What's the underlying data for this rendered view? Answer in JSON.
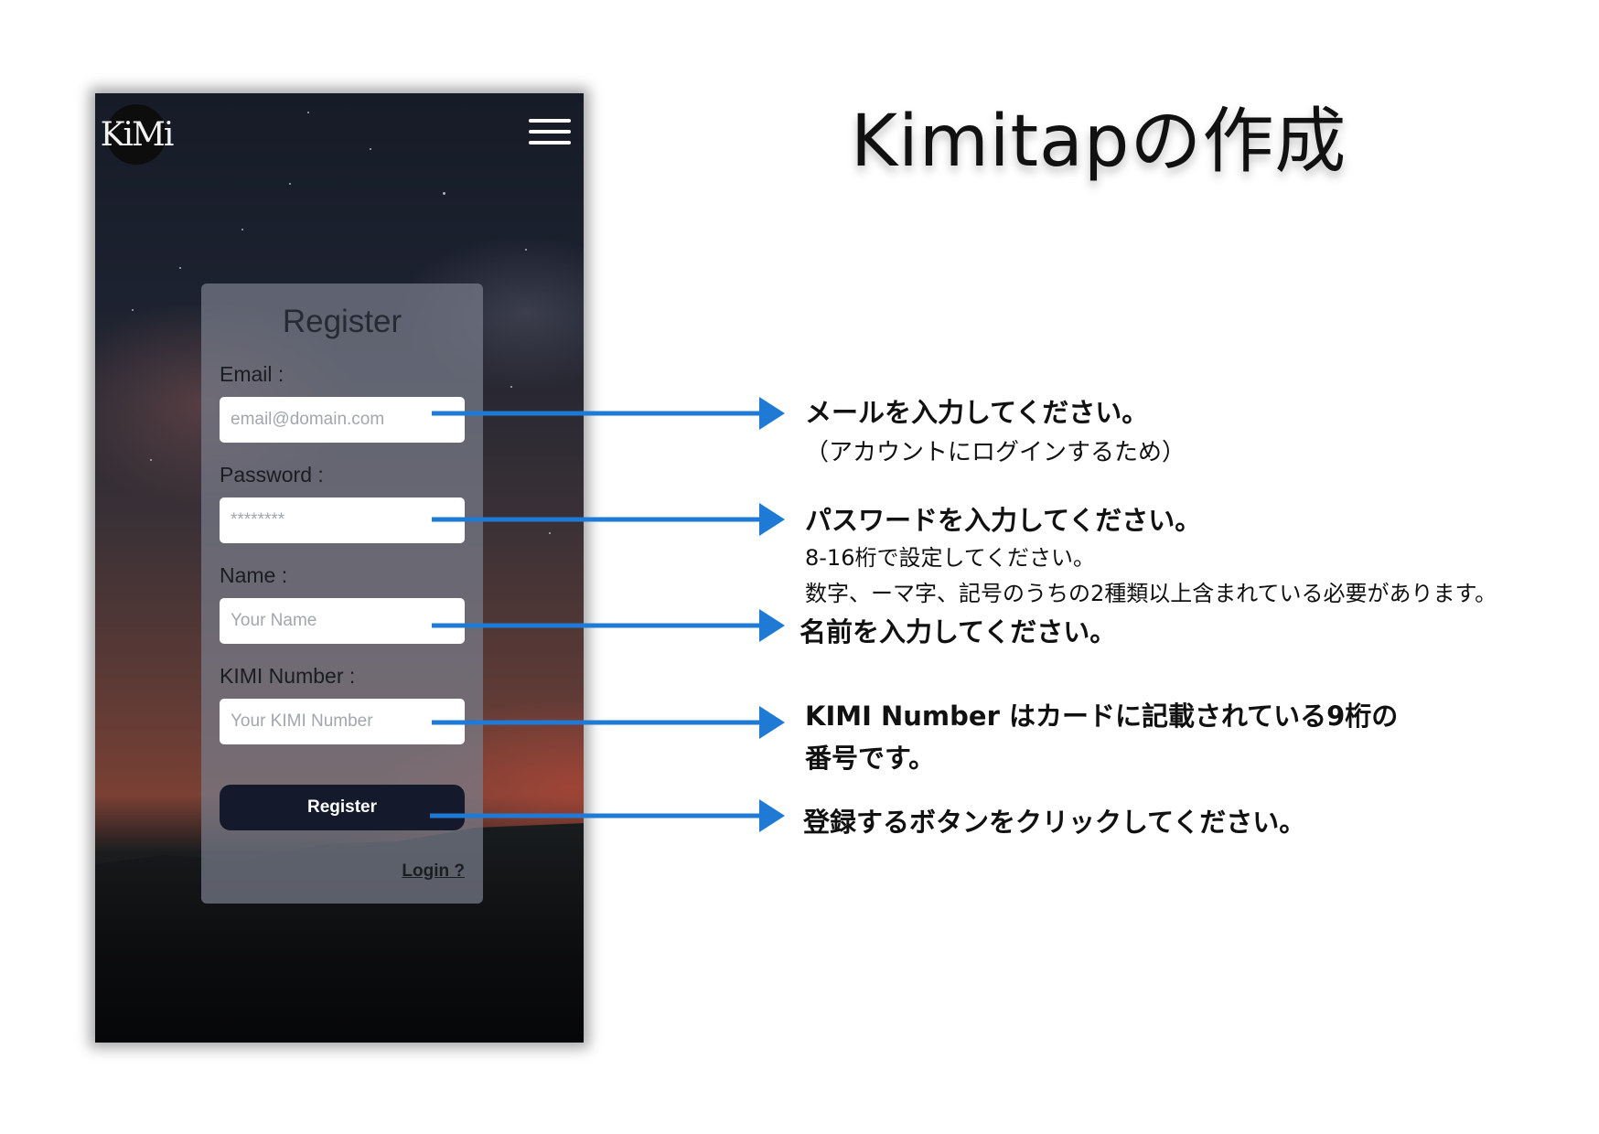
{
  "page_title": "Kimitapの作成",
  "app": {
    "logo_text": "KiMi",
    "menu_icon": "hamburger-menu-icon"
  },
  "form": {
    "title": "Register",
    "email_label": "Email :",
    "email_placeholder": "email@domain.com",
    "password_label": "Password :",
    "password_placeholder": "********",
    "name_label": "Name :",
    "name_placeholder": "Your Name",
    "kimi_label": "KIMI Number :",
    "kimi_placeholder": "Your KIMI Number",
    "register_button": "Register",
    "login_link": "Login ?"
  },
  "annotations": {
    "email": {
      "line1": "メールを入力してください。",
      "line2": "（アカウントにログインするため）"
    },
    "password": {
      "line1": "パスワードを入力してください。",
      "line2": "8-16桁で設定してください。",
      "line3": "数字、ーマ字、記号のうちの2種類以上含まれている必要があります。"
    },
    "name": {
      "line1": "名前を入力してください。"
    },
    "kimi": {
      "line1": "KIMI Number はカードに記載されている9桁の",
      "line2": "番号です。"
    },
    "register": {
      "line1": "登録するボタンをクリックしてください。"
    }
  },
  "colors": {
    "arrow": "#1f7ad6",
    "button": "#141a2b",
    "card": "#787d8a"
  }
}
